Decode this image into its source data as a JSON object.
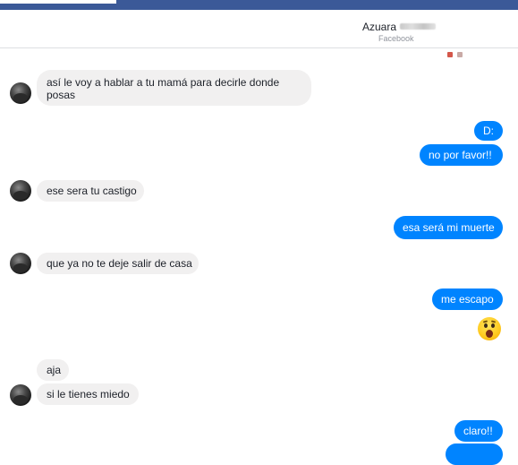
{
  "header": {
    "contact_name": "Azuara",
    "source": "Facebook"
  },
  "messages": [
    {
      "side": "in",
      "text": "así le voy a hablar a tu mamá para decirle donde posas"
    },
    {
      "side": "out",
      "text": "D:"
    },
    {
      "side": "out",
      "text": "no por favor!!"
    },
    {
      "side": "in",
      "text": "ese sera tu castigo"
    },
    {
      "side": "out",
      "text": "esa será mi muerte"
    },
    {
      "side": "in",
      "text": "que ya no te deje salir de casa"
    },
    {
      "side": "out",
      "text": "me escapo"
    },
    {
      "side": "out",
      "emoji": "astonished-face-emoji"
    },
    {
      "side": "in",
      "text": "aja"
    },
    {
      "side": "in",
      "text": "si le tienes miedo"
    },
    {
      "side": "out",
      "text": "claro!!"
    }
  ],
  "colors": {
    "facebook_bar": "#3b5998",
    "outgoing_bubble": "#0084ff",
    "incoming_bubble": "#f1f0f0",
    "background": "#ffffff"
  }
}
